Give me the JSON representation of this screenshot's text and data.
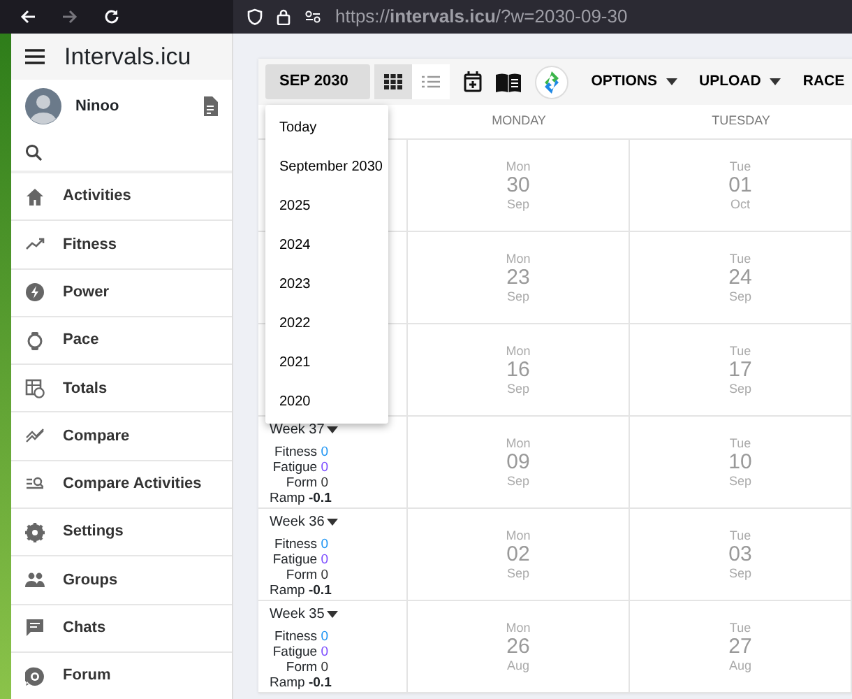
{
  "browser": {
    "url": "https://**intervals.icu**/?w=2030-09-30",
    "forward_disabled": true
  },
  "sidebar": {
    "app_title": "Intervals.icu",
    "user": "Ninoo",
    "items": [
      {
        "label": "Activities"
      },
      {
        "label": "Fitness"
      },
      {
        "label": "Power"
      },
      {
        "label": "Pace"
      },
      {
        "label": "Totals"
      },
      {
        "label": "Compare"
      },
      {
        "label": "Compare Activities"
      },
      {
        "label": "Settings"
      },
      {
        "label": "Groups"
      },
      {
        "label": "Chats"
      },
      {
        "label": "Forum"
      }
    ]
  },
  "toolbar": {
    "month_button": "SEP 2030",
    "views": [
      {
        "kind": "grid",
        "selected": true
      },
      {
        "kind": "list",
        "selected": false
      }
    ],
    "menus": [
      {
        "label": "OPTIONS"
      },
      {
        "label": "UPLOAD"
      },
      {
        "label": "RACE"
      }
    ]
  },
  "month_dropdown": [
    "Today",
    "September 2030",
    "2025",
    "2024",
    "2023",
    "2022",
    "2021",
    "2020"
  ],
  "calendar": {
    "columns": [
      "MONDAY",
      "TUESDAY"
    ],
    "weeks": [
      {
        "days": [
          {
            "weekday": "Mon",
            "day": "30",
            "month": "Sep"
          },
          {
            "weekday": "Tue",
            "day": "01",
            "month": "Oct"
          }
        ]
      },
      {
        "days": [
          {
            "weekday": "Mon",
            "day": "23",
            "month": "Sep"
          },
          {
            "weekday": "Tue",
            "day": "24",
            "month": "Sep"
          }
        ]
      },
      {
        "days": [
          {
            "weekday": "Mon",
            "day": "16",
            "month": "Sep"
          },
          {
            "weekday": "Tue",
            "day": "17",
            "month": "Sep"
          }
        ]
      },
      {
        "label": "Week 37",
        "stats": [
          {
            "label": "Fitness",
            "value": "0",
            "color": "#2196f3",
            "kind": "plain"
          },
          {
            "label": "Fatigue",
            "value": "0",
            "color": "#7c4dff",
            "kind": "plain"
          },
          {
            "label": "Form",
            "value": "0",
            "color": "#333333",
            "kind": "plain"
          },
          {
            "label": "Ramp",
            "value": "-0.1",
            "color": "#212529",
            "kind": "bold"
          }
        ],
        "days": [
          {
            "weekday": "Mon",
            "day": "09",
            "month": "Sep"
          },
          {
            "weekday": "Tue",
            "day": "10",
            "month": "Sep"
          }
        ]
      },
      {
        "label": "Week 36",
        "stats": [
          {
            "label": "Fitness",
            "value": "0",
            "color": "#2196f3",
            "kind": "plain"
          },
          {
            "label": "Fatigue",
            "value": "0",
            "color": "#7c4dff",
            "kind": "plain"
          },
          {
            "label": "Form",
            "value": "0",
            "color": "#333333",
            "kind": "plain"
          },
          {
            "label": "Ramp",
            "value": "-0.1",
            "color": "#212529",
            "kind": "bold"
          }
        ],
        "days": [
          {
            "weekday": "Mon",
            "day": "02",
            "month": "Sep"
          },
          {
            "weekday": "Tue",
            "day": "03",
            "month": "Sep"
          }
        ]
      },
      {
        "label": "Week 35",
        "stats": [
          {
            "label": "Fitness",
            "value": "0",
            "color": "#2196f3",
            "kind": "plain"
          },
          {
            "label": "Fatigue",
            "value": "0",
            "color": "#7c4dff",
            "kind": "plain"
          },
          {
            "label": "Form",
            "value": "0",
            "color": "#333333",
            "kind": "plain"
          },
          {
            "label": "Ramp",
            "value": "-0.1",
            "color": "#212529",
            "kind": "bold"
          }
        ],
        "days": [
          {
            "weekday": "Mon",
            "day": "26",
            "month": "Aug"
          },
          {
            "weekday": "Tue",
            "day": "27",
            "month": "Aug"
          }
        ]
      }
    ]
  }
}
